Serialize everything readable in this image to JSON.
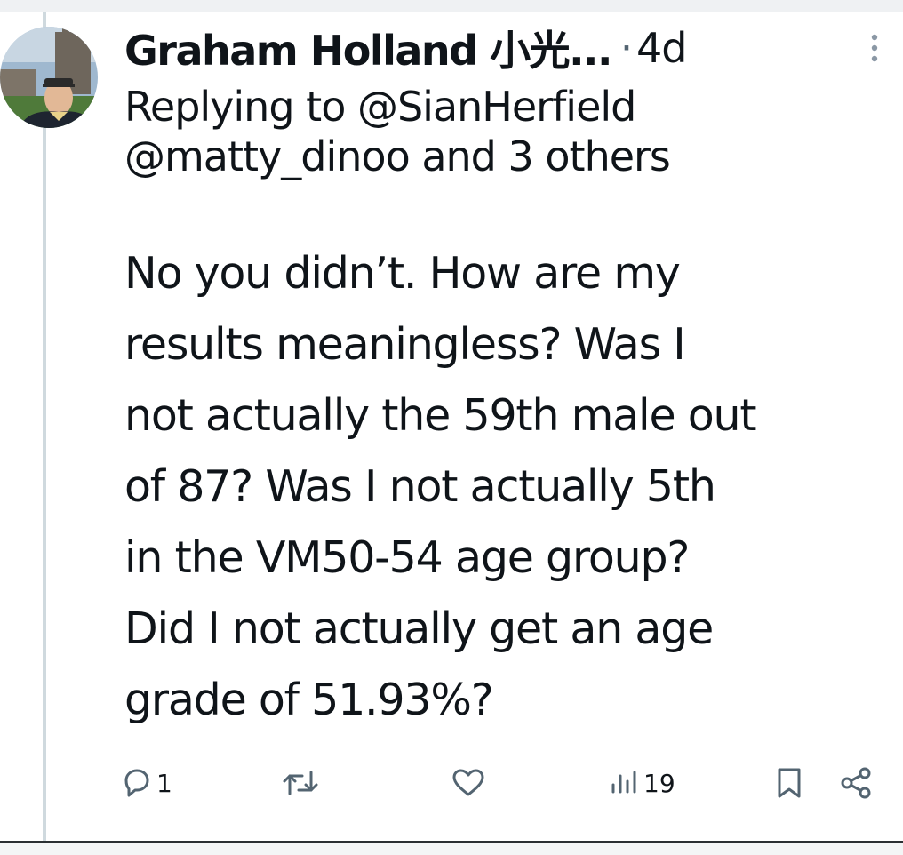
{
  "tweet": {
    "author_name": "Graham Holland 小光...",
    "separator": "·",
    "time_ago": "4d",
    "replying_prefix": "Replying to",
    "replying_handle": "@SianHerfield",
    "replying_line2": "@matty_dinoo and 3 others",
    "body_lines": [
      "No you didn’t. How are my",
      "results meaningless? Was I",
      "not actually the 59th male out",
      "of 87? Was I not actually 5th",
      "in the VM50-54 age group?",
      "Did I not actually get an age",
      "grade of 51.93%?"
    ]
  },
  "actions": {
    "reply_count": "1",
    "retweet_count": "",
    "like_count": "",
    "views_count": "19"
  },
  "icons": {
    "more": "more-vertical-icon",
    "reply": "reply-icon",
    "retweet": "retweet-icon",
    "like": "heart-icon",
    "views": "views-icon",
    "bookmark": "bookmark-icon",
    "share": "share-icon"
  },
  "colors": {
    "text": "#0f1419",
    "secondary": "#536471",
    "thread_line": "#cfd9de"
  }
}
